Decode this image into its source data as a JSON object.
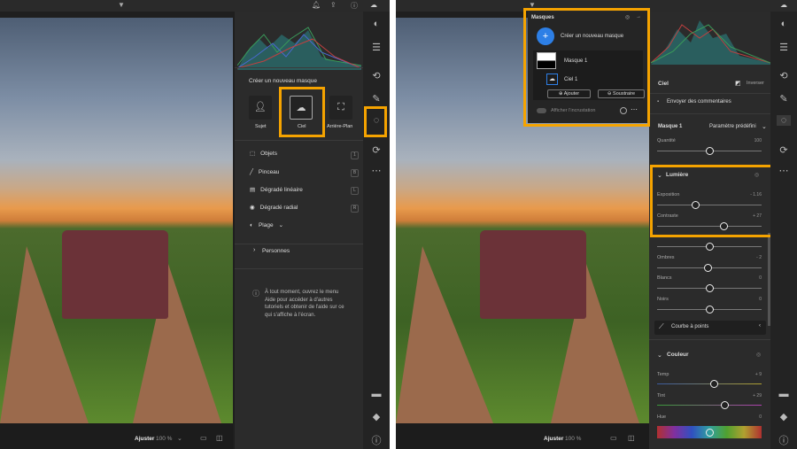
{
  "left": {
    "toolbar_icons": [
      "filter-icon",
      "bell-icon",
      "share-icon",
      "help-icon",
      "cloud-sync-icon"
    ],
    "create_mask_title": "Créer un nouveau masque",
    "mask_types": [
      {
        "label": "Sujet",
        "icon": "subject-icon"
      },
      {
        "label": "Ciel",
        "icon": "sky-icon",
        "selected": true
      },
      {
        "label": "Arrière-Plan",
        "icon": "background-icon"
      }
    ],
    "tools": [
      {
        "label": "Objets",
        "key": "1"
      },
      {
        "label": "Pinceau",
        "key": "B"
      },
      {
        "label": "Dégradé linéaire",
        "key": "L"
      },
      {
        "label": "Dégradé radial",
        "key": "R"
      },
      {
        "label": "Plage"
      }
    ],
    "people_label": "Personnes",
    "help_text": "À tout moment, ouvrez le menu Aide pour accéder à d'autres tutoriels et obtenir de l'aide sur ce qui s'affiche à l'écran.",
    "fit_label": "Ajuster",
    "zoom_level": "100 %"
  },
  "right": {
    "masks_panel": {
      "title": "Masques",
      "create_label": "Créer un nouveau masque",
      "mask_name": "Masque 1",
      "component_name": "Ciel 1",
      "add_label": "Ajouter",
      "subtract_label": "Soustraire",
      "overlay_label": "Afficher l'incrustation"
    },
    "component_title": "Ciel",
    "invert_label": "Inverser",
    "feedback_label": "Envoyer des commentaires",
    "mask_label": "Masque 1",
    "preset_label": "Paramètre prédéfini",
    "amount": {
      "label": "Quantité",
      "value": "100",
      "fraction": 0.5
    },
    "light_section": "Lumière",
    "light_sliders": [
      {
        "label": "Exposition",
        "value": "- 1.16",
        "fraction": 0.37
      },
      {
        "label": "Contraste",
        "value": "+ 27",
        "fraction": 0.64
      }
    ],
    "hidden_slider_fraction": 0.5,
    "more_sliders": [
      {
        "label": "Ombres",
        "value": "- 2",
        "fraction": 0.49
      },
      {
        "label": "Blancs",
        "value": "0",
        "fraction": 0.5
      },
      {
        "label": "Noirs",
        "value": "0",
        "fraction": 0.5
      }
    ],
    "curve_label": "Courbe à points",
    "color_section": "Couleur",
    "color_sliders": [
      {
        "label": "Temp",
        "value": "+ 9",
        "fraction": 0.55
      },
      {
        "label": "Tint",
        "value": "+ 29",
        "fraction": 0.65
      },
      {
        "label": "Hue",
        "value": "0",
        "fraction": 0.5
      }
    ],
    "fit_label": "Ajuster",
    "zoom_level": "100 %"
  },
  "colors": {
    "highlight": "#f5a300",
    "accent": "#2d7fe6"
  }
}
